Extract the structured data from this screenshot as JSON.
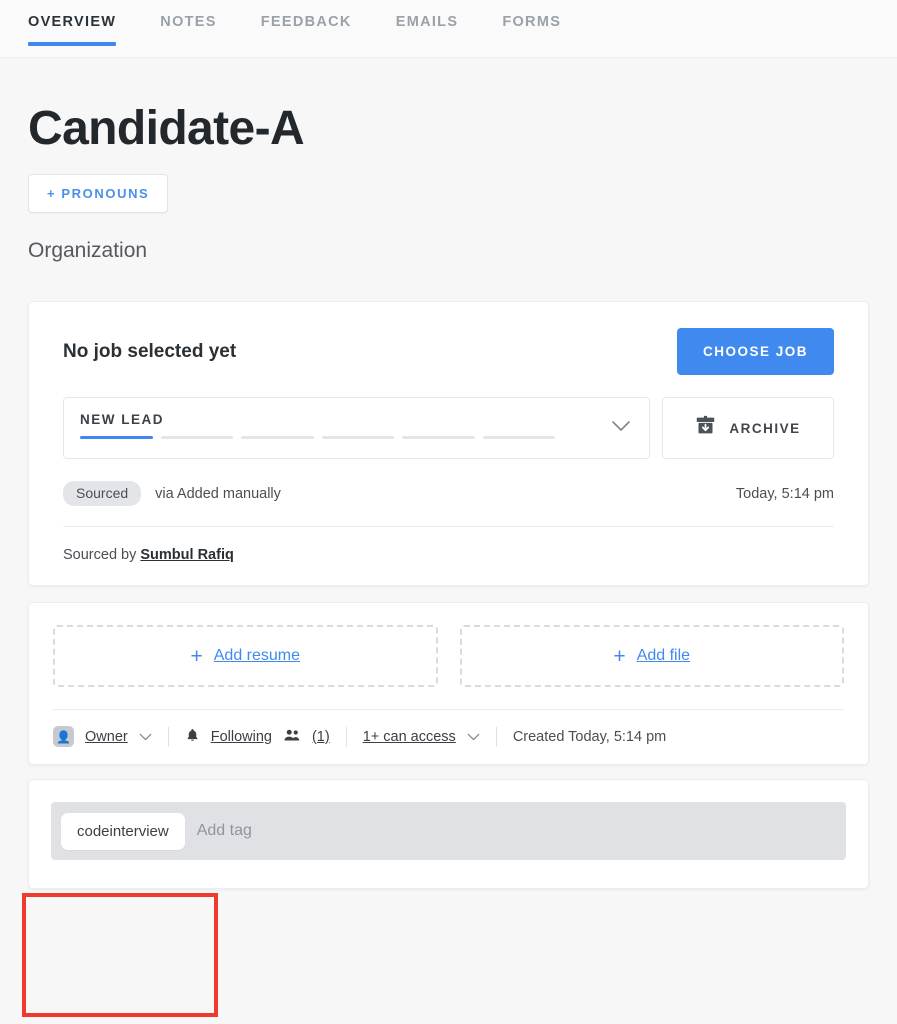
{
  "tabs": [
    {
      "label": "OVERVIEW",
      "active": true
    },
    {
      "label": "NOTES",
      "active": false
    },
    {
      "label": "FEEDBACK",
      "active": false
    },
    {
      "label": "EMAILS",
      "active": false
    },
    {
      "label": "FORMS",
      "active": false
    }
  ],
  "header": {
    "candidate_name": "Candidate-A",
    "pronouns_label": "+ PRONOUNS",
    "organization": "Organization"
  },
  "job_card": {
    "title": "No job selected yet",
    "choose_job_label": "CHOOSE JOB",
    "stage": {
      "value": "NEW LEAD",
      "segments_total": 6,
      "segments_filled": 1
    },
    "archive_label": "ARCHIVE",
    "status_pill": "Sourced",
    "via_text": "via Added manually",
    "timestamp": "Today, 5:14 pm",
    "sourced_by_prefix": "Sourced by",
    "sourced_by_name": "Sumbul Rafiq"
  },
  "files_card": {
    "add_resume_label": "Add resume",
    "add_file_label": "Add file",
    "plus": "+",
    "meta": {
      "owner_label": "Owner",
      "following_label": "Following",
      "followers_count": "(1)",
      "access_label": "1+ can access",
      "created_text": "Created Today, 5:14 pm"
    }
  },
  "tags_card": {
    "tags": [
      "codeinterview"
    ],
    "placeholder": "Add tag"
  },
  "colors": {
    "accent_blue": "#4089ef",
    "page_bg": "#f7f7f8",
    "annotation_red": "#ef3b2d",
    "tag_field_bg": "#dfe1e5"
  }
}
